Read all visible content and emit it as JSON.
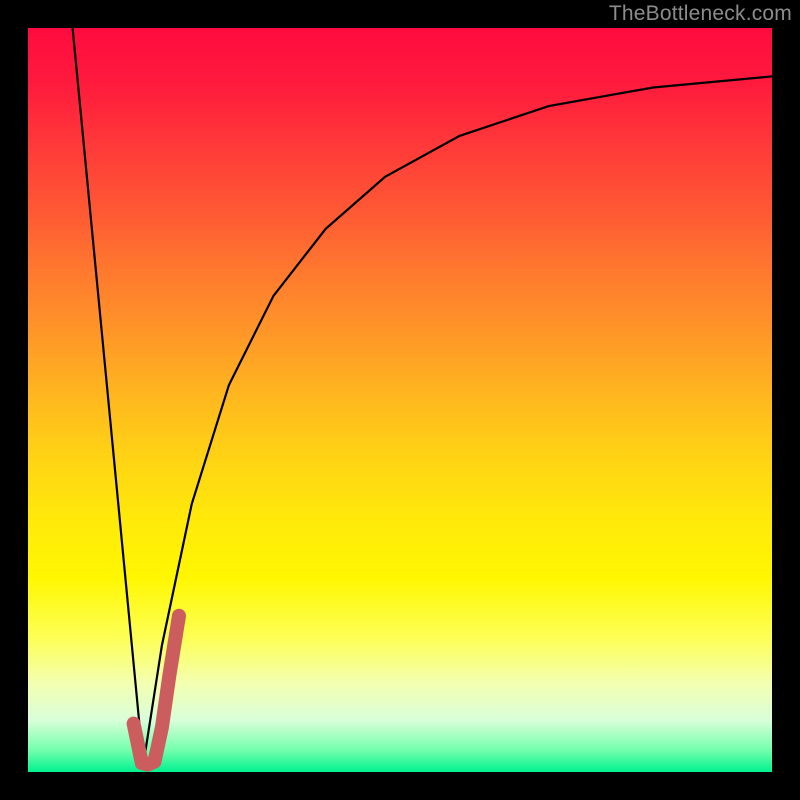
{
  "watermark": {
    "text": "TheBottleneck.com"
  },
  "chart_data": {
    "type": "line",
    "title": "",
    "xlabel": "",
    "ylabel": "",
    "xlim": [
      0,
      100
    ],
    "ylim": [
      0,
      100
    ],
    "grid": false,
    "legend": false,
    "series": [
      {
        "name": "left-descent",
        "x": [
          6,
          15.5
        ],
        "values": [
          100,
          1
        ]
      },
      {
        "name": "right-ascent",
        "x": [
          15.5,
          18,
          22,
          27,
          33,
          40,
          48,
          58,
          70,
          84,
          100
        ],
        "values": [
          1,
          17,
          36,
          52,
          64,
          73,
          80,
          85.5,
          89.5,
          92,
          93.5
        ]
      },
      {
        "name": "highlight-j",
        "x": [
          14.2,
          15.3,
          16.1,
          17.0,
          18.0,
          19.0,
          20.3
        ],
        "values": [
          6.5,
          1.2,
          1.0,
          1.4,
          6.0,
          13.0,
          21.0
        ]
      }
    ],
    "background_gradient": {
      "direction": "vertical",
      "stops": [
        {
          "pos": 0.0,
          "color": "#ff0b3e"
        },
        {
          "pos": 0.5,
          "color": "#ffb91e"
        },
        {
          "pos": 0.74,
          "color": "#fff702"
        },
        {
          "pos": 0.93,
          "color": "#d9ffd9"
        },
        {
          "pos": 1.0,
          "color": "#00f28f"
        }
      ]
    }
  }
}
